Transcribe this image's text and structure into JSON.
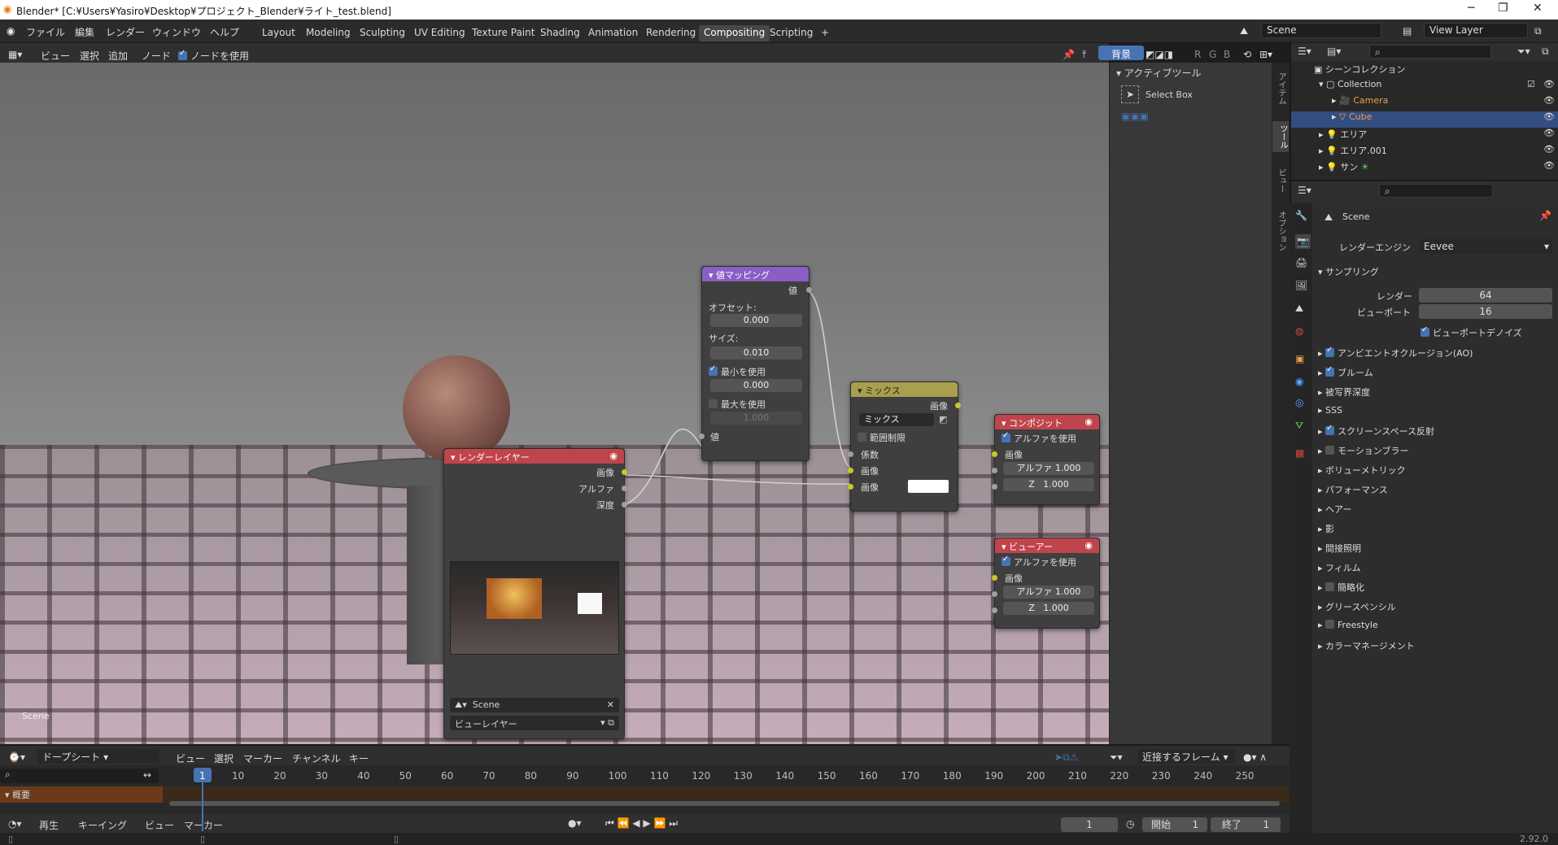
{
  "titlebar": {
    "title": "Blender* [C:¥Users¥Yasiro¥Desktop¥プロジェクト_Blender¥ライト_test.blend]",
    "minimize": "─",
    "maximize": "❐",
    "close": "✕"
  },
  "menu": [
    "ファイル",
    "編集",
    "レンダー",
    "ウィンドウ",
    "ヘルプ"
  ],
  "workspaces": [
    "Layout",
    "Modeling",
    "Sculpting",
    "UV Editing",
    "Texture Paint",
    "Shading",
    "Animation",
    "Rendering",
    "Compositing",
    "Scripting",
    "+"
  ],
  "active_workspace": "Compositing",
  "scene_selector": "Scene",
  "view_layer_selector": "View Layer",
  "node_header": {
    "menus": [
      "ビュー",
      "選択",
      "追加",
      "ノード"
    ],
    "use_nodes": "ノードを使用",
    "backdrop": "背景",
    "channels": [
      "R",
      "G",
      "B"
    ]
  },
  "viewport_scene_label": "Scene",
  "nodes": {
    "map_value": {
      "title": "値マッピング",
      "out_value": "値",
      "offset_label": "オフセット:",
      "offset": "0.000",
      "size_label": "サイズ:",
      "size": "0.010",
      "use_min": "最小を使用",
      "min": "0.000",
      "use_max": "最大を使用",
      "max": "1.000",
      "in_value": "値"
    },
    "mix": {
      "title": "ミックス",
      "out_image": "画像",
      "blend": "ミックス",
      "clamp": "範囲制限",
      "fac": "係数",
      "image1": "画像",
      "image2": "画像"
    },
    "render_layers": {
      "title": "レンダーレイヤー",
      "out_image": "画像",
      "out_alpha": "アルファ",
      "out_depth": "深度",
      "scene": "Scene",
      "layer": "ビューレイヤー"
    },
    "composite": {
      "title": "コンポジット",
      "use_alpha": "アルファを使用",
      "image": "画像",
      "alpha_label": "アルファ",
      "alpha": "1.000",
      "z_label": "Z",
      "z": "1.000"
    },
    "viewer": {
      "title": "ビューアー",
      "use_alpha": "アルファを使用",
      "image": "画像",
      "alpha_label": "アルファ",
      "alpha": "1.000",
      "z_label": "Z",
      "z": "1.000"
    }
  },
  "npanel": {
    "header": "アクティブツール",
    "tool": "Select Box",
    "tabs": [
      "アイテム",
      "ツール",
      "ビュー",
      "オプション"
    ]
  },
  "outliner": {
    "root": "シーンコレクション",
    "items": [
      {
        "label": "Collection",
        "color": "#dddddd"
      },
      {
        "label": "Camera",
        "color": "#e8a04c"
      },
      {
        "label": "Cube",
        "color": "#e8a04c"
      },
      {
        "label": "エリア",
        "color": "#dddddd"
      },
      {
        "label": "エリア.001",
        "color": "#dddddd"
      },
      {
        "label": "サン",
        "color": "#dddddd"
      }
    ]
  },
  "properties": {
    "scene": "Scene",
    "render_engine_label": "レンダーエンジン",
    "render_engine": "Eevee",
    "sampling": "サンプリング",
    "render_label": "レンダー",
    "render": "64",
    "viewport_label": "ビューポート",
    "viewport": "16",
    "viewport_denoise": "ビューポートデノイズ",
    "panels": [
      {
        "label": "アンビエントオクルージョン(AO)",
        "cb": "on"
      },
      {
        "label": "ブルーム",
        "cb": "on"
      },
      {
        "label": "被写界深度",
        "cb": "none"
      },
      {
        "label": "SSS",
        "cb": "none"
      },
      {
        "label": "スクリーンスペース反射",
        "cb": "on"
      },
      {
        "label": "モーションブラー",
        "cb": "off"
      },
      {
        "label": "ボリューメトリック",
        "cb": "none"
      },
      {
        "label": "パフォーマンス",
        "cb": "none"
      },
      {
        "label": "ヘアー",
        "cb": "none"
      },
      {
        "label": "影",
        "cb": "none"
      },
      {
        "label": "間接照明",
        "cb": "none"
      },
      {
        "label": "フィルム",
        "cb": "none"
      },
      {
        "label": "簡略化",
        "cb": "off"
      },
      {
        "label": "グリースペンシル",
        "cb": "none"
      },
      {
        "label": "Freestyle",
        "cb": "off"
      },
      {
        "label": "カラーマネージメント",
        "cb": "none"
      }
    ]
  },
  "timeline": {
    "editor": "ドープシート",
    "menus": [
      "ビュー",
      "選択",
      "マーカー",
      "チャンネル",
      "キー"
    ],
    "snap": "近接するフレーム",
    "summary": "概要",
    "ticks": [
      "1",
      "10",
      "20",
      "30",
      "40",
      "50",
      "60",
      "70",
      "80",
      "90",
      "100",
      "110",
      "120",
      "130",
      "140",
      "150",
      "160",
      "170",
      "180",
      "190",
      "200",
      "210",
      "220",
      "230",
      "240",
      "250"
    ],
    "playback": "再生",
    "keying": "キーイング",
    "view": "ビュー",
    "marker": "マーカー",
    "current_frame": "1",
    "start_label": "開始",
    "start": "1",
    "end_label": "終了",
    "end": "1"
  },
  "version": "2.92.0"
}
